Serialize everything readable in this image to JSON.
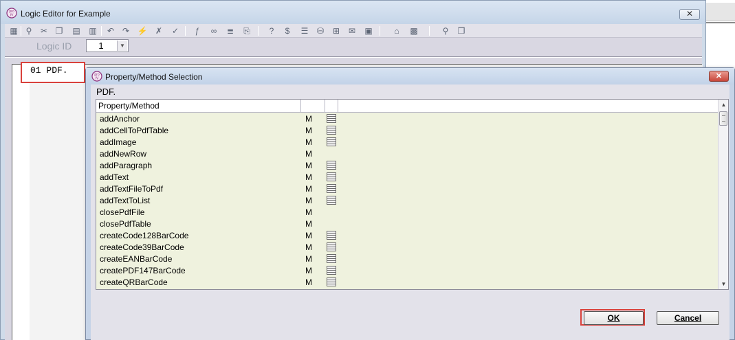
{
  "editor": {
    "title": "Logic Editor for Example",
    "close_label": "✕",
    "logic_id_label": "Logic ID",
    "logic_id_value": "1",
    "code_line": "01 PDF."
  },
  "dialog": {
    "title": "Property/Method Selection",
    "close_label": "✕",
    "heading": "PDF.",
    "columns": [
      "Property/Method",
      "",
      ""
    ],
    "rows": [
      {
        "name": "addAnchor",
        "kind": "M",
        "doc": true
      },
      {
        "name": "addCellToPdfTable",
        "kind": "M",
        "doc": true
      },
      {
        "name": "addImage",
        "kind": "M",
        "doc": true
      },
      {
        "name": "addNewRow",
        "kind": "M",
        "doc": false
      },
      {
        "name": "addParagraph",
        "kind": "M",
        "doc": true
      },
      {
        "name": "addText",
        "kind": "M",
        "doc": true
      },
      {
        "name": "addTextFileToPdf",
        "kind": "M",
        "doc": true
      },
      {
        "name": "addTextToList",
        "kind": "M",
        "doc": true
      },
      {
        "name": "closePdfFile",
        "kind": "M",
        "doc": false
      },
      {
        "name": "closePdfTable",
        "kind": "M",
        "doc": false
      },
      {
        "name": "createCode128BarCode",
        "kind": "M",
        "doc": true
      },
      {
        "name": "createCode39BarCode",
        "kind": "M",
        "doc": true
      },
      {
        "name": "createEANBarCode",
        "kind": "M",
        "doc": true
      },
      {
        "name": "createPDF147BarCode",
        "kind": "M",
        "doc": true
      },
      {
        "name": "createQRBarCode",
        "kind": "M",
        "doc": true
      }
    ],
    "ok_label": "OK",
    "cancel_label": "Cancel"
  },
  "icons": {
    "app": "app-icon",
    "toolbar": [
      "grid-icon",
      "find-icon",
      "cut-icon",
      "copy-icon",
      "paste-icon",
      "paste-special-icon",
      "undo-icon",
      "redo-icon",
      "insert-icon",
      "delete-icon",
      "check-icon",
      "function-icon",
      "link-icon",
      "text-icon",
      "script-icon",
      "help-icon",
      "dollar-icon",
      "list-icon",
      "database-icon",
      "object-icon",
      "bubble-icon",
      "image-icon",
      "open-icon",
      "save-icon",
      "zoom-icon",
      "book-icon"
    ]
  },
  "colors": {
    "highlight": "#d9413b",
    "table_bg": "#eff2de"
  }
}
